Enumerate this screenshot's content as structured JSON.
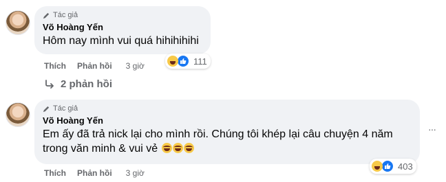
{
  "comments": [
    {
      "badge": "Tác giả",
      "author": "Võ Hoàng Yến",
      "text": "Hôm nay mình vui quá hihihihihi",
      "actions": {
        "like": "Thích",
        "reply": "Phản hồi",
        "time": "3 giờ"
      },
      "reactions": {
        "icons": [
          "haha-icon",
          "like-icon"
        ],
        "count": "111"
      },
      "replies": "2 phản hồi"
    },
    {
      "badge": "Tác giả",
      "author": "Võ Hoàng Yến",
      "text_line1": "Em ấy đã trả nick lại cho mình rồi. Chúng tôi khép lại câu chuyện 4 năm",
      "text_line2": "trong văn minh & vui vẻ",
      "actions": {
        "like": "Thích",
        "reply": "Phản hồi",
        "time": "3 giờ"
      },
      "reactions": {
        "icons": [
          "haha-icon",
          "like-icon"
        ],
        "count": "403"
      },
      "more": "···"
    }
  ],
  "colors": {
    "bubble": "#f0f2f5",
    "meta": "#65676b",
    "like_blue": "#1877f2",
    "haha": "#f7c948"
  }
}
